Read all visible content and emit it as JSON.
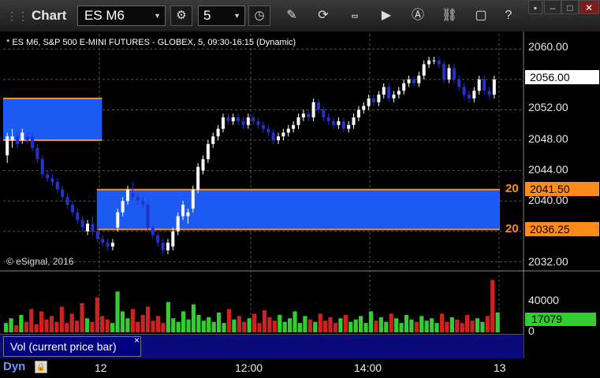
{
  "toolbar": {
    "app_title": "Chart",
    "symbol": "ES M6",
    "interval": "5"
  },
  "chart": {
    "header": "* ES M6, S&P 500 E-MINI FUTURES - GLOBEX, 5, 09:30-16:15 (Dynamic)",
    "copyright": "© eSignal, 2016",
    "price_axis": [
      "2060.00",
      "2052.00",
      "2048.00",
      "2044.00",
      "2040.00",
      "2032.00"
    ],
    "current_price": "2056.00",
    "level_upper": "2041.50",
    "level_lower": "2036.25",
    "level_tag": "20",
    "colors": {
      "up": "#ffffff",
      "down": "#2233cc",
      "zone": "#1f5fff",
      "level": "#ff8c1a",
      "bg": "#000000"
    }
  },
  "volume": {
    "axis": [
      "40000",
      "0"
    ],
    "current": "17079",
    "study_label": "Vol (current price bar)",
    "close_glyph": "×"
  },
  "time_axis": {
    "labels": [
      "12",
      "12:00",
      "14:00",
      "13"
    ],
    "dyn_label": "Dyn"
  },
  "chart_data": {
    "type": "candlestick",
    "ylim": [
      2031,
      2062
    ],
    "candles": [
      {
        "o": 2046,
        "h": 2049,
        "l": 2045,
        "c": 2048.5
      },
      {
        "o": 2048,
        "h": 2049.5,
        "l": 2047,
        "c": 2048.5
      },
      {
        "o": 2048.5,
        "h": 2049,
        "l": 2047,
        "c": 2047.5
      },
      {
        "o": 2048,
        "h": 2049.5,
        "l": 2047.5,
        "c": 2049
      },
      {
        "o": 2048.5,
        "h": 2049,
        "l": 2047.5,
        "c": 2048
      },
      {
        "o": 2048.5,
        "h": 2049,
        "l": 2046.5,
        "c": 2047
      },
      {
        "o": 2047,
        "h": 2047.5,
        "l": 2045,
        "c": 2045.5
      },
      {
        "o": 2045.5,
        "h": 2046,
        "l": 2043,
        "c": 2043.5
      },
      {
        "o": 2043.5,
        "h": 2044,
        "l": 2042.5,
        "c": 2043
      },
      {
        "o": 2043,
        "h": 2043.5,
        "l": 2042,
        "c": 2042.5
      },
      {
        "o": 2042.5,
        "h": 2043,
        "l": 2041,
        "c": 2041.5
      },
      {
        "o": 2041.5,
        "h": 2042,
        "l": 2040,
        "c": 2040.5
      },
      {
        "o": 2040.5,
        "h": 2041,
        "l": 2039,
        "c": 2039.5
      },
      {
        "o": 2039.5,
        "h": 2040,
        "l": 2038,
        "c": 2038.5
      },
      {
        "o": 2038.5,
        "h": 2039,
        "l": 2037,
        "c": 2037.5
      },
      {
        "o": 2037.5,
        "h": 2038,
        "l": 2036,
        "c": 2036.5
      },
      {
        "o": 2036,
        "h": 2037.5,
        "l": 2035.5,
        "c": 2037
      },
      {
        "o": 2037,
        "h": 2038,
        "l": 2035.5,
        "c": 2036
      },
      {
        "o": 2036,
        "h": 2036.5,
        "l": 2034.5,
        "c": 2035
      },
      {
        "o": 2035,
        "h": 2035.5,
        "l": 2034,
        "c": 2034.5
      },
      {
        "o": 2034.5,
        "h": 2035,
        "l": 2033.5,
        "c": 2034
      },
      {
        "o": 2034,
        "h": 2035,
        "l": 2033.5,
        "c": 2034.5
      },
      {
        "o": 2036.5,
        "h": 2039,
        "l": 2036,
        "c": 2038.5
      },
      {
        "o": 2038.5,
        "h": 2040.5,
        "l": 2038,
        "c": 2040
      },
      {
        "o": 2040,
        "h": 2042,
        "l": 2039.5,
        "c": 2041.5
      },
      {
        "o": 2041,
        "h": 2042.5,
        "l": 2040,
        "c": 2040.5
      },
      {
        "o": 2040.5,
        "h": 2041,
        "l": 2039.5,
        "c": 2040
      },
      {
        "o": 2040,
        "h": 2040.5,
        "l": 2039,
        "c": 2039.5
      },
      {
        "o": 2039.5,
        "h": 2040,
        "l": 2036,
        "c": 2036.5
      },
      {
        "o": 2036.5,
        "h": 2037,
        "l": 2035,
        "c": 2035.5
      },
      {
        "o": 2035.5,
        "h": 2036,
        "l": 2034,
        "c": 2034.5
      },
      {
        "o": 2034.5,
        "h": 2035,
        "l": 2033,
        "c": 2033.5
      },
      {
        "o": 2033.5,
        "h": 2035,
        "l": 2033,
        "c": 2034.5
      },
      {
        "o": 2034,
        "h": 2036.5,
        "l": 2033.5,
        "c": 2036
      },
      {
        "o": 2036,
        "h": 2038.5,
        "l": 2035.5,
        "c": 2038
      },
      {
        "o": 2038,
        "h": 2040,
        "l": 2037.5,
        "c": 2039.5
      },
      {
        "o": 2038,
        "h": 2039,
        "l": 2037,
        "c": 2038.5
      },
      {
        "o": 2039,
        "h": 2042,
        "l": 2038.5,
        "c": 2041.5
      },
      {
        "o": 2041.5,
        "h": 2045,
        "l": 2041,
        "c": 2044.5
      },
      {
        "o": 2044,
        "h": 2046,
        "l": 2043.5,
        "c": 2045.5
      },
      {
        "o": 2045.5,
        "h": 2048,
        "l": 2045,
        "c": 2047.5
      },
      {
        "o": 2047.5,
        "h": 2049,
        "l": 2047,
        "c": 2048.5
      },
      {
        "o": 2048.5,
        "h": 2050,
        "l": 2048,
        "c": 2049.5
      },
      {
        "o": 2049.5,
        "h": 2051.5,
        "l": 2049,
        "c": 2051
      },
      {
        "o": 2051,
        "h": 2051.5,
        "l": 2050,
        "c": 2050.5
      },
      {
        "o": 2050.5,
        "h": 2051.5,
        "l": 2050,
        "c": 2051
      },
      {
        "o": 2051,
        "h": 2051.5,
        "l": 2050,
        "c": 2050.5
      },
      {
        "o": 2050.5,
        "h": 2051,
        "l": 2049.5,
        "c": 2050
      },
      {
        "o": 2050,
        "h": 2051.5,
        "l": 2049.5,
        "c": 2051
      },
      {
        "o": 2051,
        "h": 2051.5,
        "l": 2050,
        "c": 2050.5
      },
      {
        "o": 2050.5,
        "h": 2051,
        "l": 2049.5,
        "c": 2050
      },
      {
        "o": 2050,
        "h": 2050.5,
        "l": 2049,
        "c": 2049.5
      },
      {
        "o": 2049.5,
        "h": 2050,
        "l": 2048.5,
        "c": 2049
      },
      {
        "o": 2049,
        "h": 2049.5,
        "l": 2047.5,
        "c": 2048
      },
      {
        "o": 2048,
        "h": 2049,
        "l": 2047.5,
        "c": 2048.5
      },
      {
        "o": 2048.5,
        "h": 2049.5,
        "l": 2048,
        "c": 2049
      },
      {
        "o": 2049,
        "h": 2050,
        "l": 2048.5,
        "c": 2049.5
      },
      {
        "o": 2049.5,
        "h": 2050.5,
        "l": 2049,
        "c": 2050
      },
      {
        "o": 2050,
        "h": 2051.5,
        "l": 2049.5,
        "c": 2051
      },
      {
        "o": 2051,
        "h": 2052,
        "l": 2050.5,
        "c": 2051.5
      },
      {
        "o": 2051.5,
        "h": 2052,
        "l": 2050.5,
        "c": 2051
      },
      {
        "o": 2051,
        "h": 2053.5,
        "l": 2050.5,
        "c": 2053
      },
      {
        "o": 2053,
        "h": 2053.5,
        "l": 2051.5,
        "c": 2052
      },
      {
        "o": 2052,
        "h": 2052.5,
        "l": 2050.5,
        "c": 2051
      },
      {
        "o": 2051,
        "h": 2051.5,
        "l": 2050,
        "c": 2050.5
      },
      {
        "o": 2050.5,
        "h": 2051,
        "l": 2049.5,
        "c": 2050
      },
      {
        "o": 2050,
        "h": 2051,
        "l": 2049.5,
        "c": 2050.5
      },
      {
        "o": 2050.5,
        "h": 2051,
        "l": 2049,
        "c": 2049.5
      },
      {
        "o": 2049.5,
        "h": 2050.5,
        "l": 2049,
        "c": 2050
      },
      {
        "o": 2050,
        "h": 2051.5,
        "l": 2049.5,
        "c": 2051
      },
      {
        "o": 2051,
        "h": 2052.5,
        "l": 2050.5,
        "c": 2052
      },
      {
        "o": 2052,
        "h": 2053,
        "l": 2051.5,
        "c": 2052.5
      },
      {
        "o": 2052.5,
        "h": 2054,
        "l": 2052,
        "c": 2053.5
      },
      {
        "o": 2053.5,
        "h": 2054,
        "l": 2052.5,
        "c": 2053
      },
      {
        "o": 2053,
        "h": 2054.5,
        "l": 2052.5,
        "c": 2054
      },
      {
        "o": 2054,
        "h": 2055.5,
        "l": 2053.5,
        "c": 2055
      },
      {
        "o": 2055,
        "h": 2055.5,
        "l": 2053,
        "c": 2053.5
      },
      {
        "o": 2053.5,
        "h": 2054.5,
        "l": 2053,
        "c": 2054
      },
      {
        "o": 2054,
        "h": 2055,
        "l": 2053.5,
        "c": 2054.5
      },
      {
        "o": 2054.5,
        "h": 2056,
        "l": 2054,
        "c": 2055.5
      },
      {
        "o": 2055.5,
        "h": 2056.5,
        "l": 2055,
        "c": 2056
      },
      {
        "o": 2056,
        "h": 2056.5,
        "l": 2055,
        "c": 2055.5
      },
      {
        "o": 2055.5,
        "h": 2057,
        "l": 2055,
        "c": 2056.5
      },
      {
        "o": 2056.5,
        "h": 2058.5,
        "l": 2056,
        "c": 2058
      },
      {
        "o": 2058,
        "h": 2059,
        "l": 2057.5,
        "c": 2058.5
      },
      {
        "o": 2058.5,
        "h": 2059,
        "l": 2058,
        "c": 2058.5
      },
      {
        "o": 2058.5,
        "h": 2059,
        "l": 2057.5,
        "c": 2058
      },
      {
        "o": 2058,
        "h": 2058.5,
        "l": 2055.5,
        "c": 2056
      },
      {
        "o": 2056,
        "h": 2058,
        "l": 2055.5,
        "c": 2057.5
      },
      {
        "o": 2057.5,
        "h": 2058,
        "l": 2055.5,
        "c": 2056
      },
      {
        "o": 2056,
        "h": 2056.5,
        "l": 2054.5,
        "c": 2055
      },
      {
        "o": 2055,
        "h": 2055.5,
        "l": 2053.5,
        "c": 2054
      },
      {
        "o": 2054,
        "h": 2054.5,
        "l": 2053,
        "c": 2053.5
      },
      {
        "o": 2053.5,
        "h": 2055,
        "l": 2053,
        "c": 2054.5
      },
      {
        "o": 2054.5,
        "h": 2056.5,
        "l": 2054,
        "c": 2056
      },
      {
        "o": 2056,
        "h": 2056.5,
        "l": 2054,
        "c": 2054.5
      },
      {
        "o": 2054.5,
        "h": 2055,
        "l": 2053.5,
        "c": 2054
      },
      {
        "o": 2054,
        "h": 2056.5,
        "l": 2053.5,
        "c": 2056
      }
    ],
    "zones": [
      {
        "from": 2048,
        "to": 2053.5,
        "x_end_fraction": 0.19
      },
      {
        "from": 2036.25,
        "to": 2041.5,
        "x_start_fraction": 0.18
      }
    ],
    "volume": [
      8000,
      12000,
      6000,
      15000,
      9000,
      20000,
      7000,
      18000,
      11000,
      14000,
      9000,
      22000,
      8000,
      16000,
      10000,
      25000,
      12000,
      9000,
      30000,
      14000,
      11000,
      8000,
      35000,
      18000,
      12000,
      20000,
      9000,
      15000,
      22000,
      10000,
      14000,
      8000,
      26000,
      12000,
      9000,
      18000,
      11000,
      24000,
      15000,
      10000,
      13000,
      9000,
      17000,
      8000,
      20000,
      11000,
      14000,
      9000,
      12000,
      16000,
      8000,
      19000,
      13000,
      10000,
      15000,
      9000,
      12000,
      18000,
      8000,
      14000,
      11000,
      9000,
      16000,
      10000,
      13000,
      8000,
      12000,
      15000,
      9000,
      11000,
      14000,
      8000,
      18000,
      10000,
      13000,
      9000,
      16000,
      12000,
      8000,
      15000,
      11000,
      9000,
      14000,
      10000,
      12000,
      8000,
      16000,
      9000,
      13000,
      11000,
      8000,
      15000,
      10000,
      12000,
      9000,
      14000,
      45000,
      17079
    ]
  }
}
